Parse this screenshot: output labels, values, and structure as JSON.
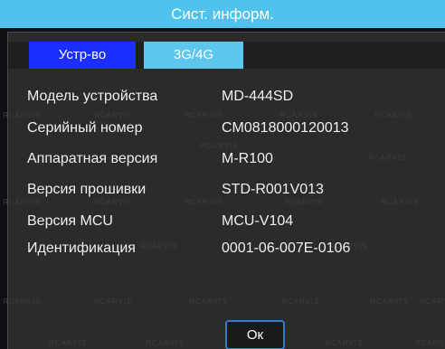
{
  "window": {
    "title": "Сист. информ."
  },
  "tabs": [
    {
      "label": "Устр-во",
      "active": true
    },
    {
      "label": "3G/4G",
      "active": false
    }
  ],
  "info_rows": [
    {
      "label": "Модель устройства",
      "value": "MD-444SD"
    },
    {
      "label": "Серийный номер",
      "value": "CM0818000120013"
    },
    {
      "label": "Аппаратная версия",
      "value": "M-R100"
    },
    {
      "label": "Версия прошивки",
      "value": "STD-R001V013"
    },
    {
      "label": "Версия MCU",
      "value": "MCU-V104"
    },
    {
      "label": "Идентификация",
      "value": "0001-06-007E-0106"
    }
  ],
  "watermark": {
    "text": "ЯCARVIS"
  },
  "footer": {
    "ok_label": "Ок"
  },
  "colors": {
    "title_bar": "#4fc3ee",
    "active_tab": "#1a2eff",
    "inactive_tab": "#5cc6ee",
    "panel": "#2b2b2b",
    "button_border": "#2f7dd4"
  }
}
